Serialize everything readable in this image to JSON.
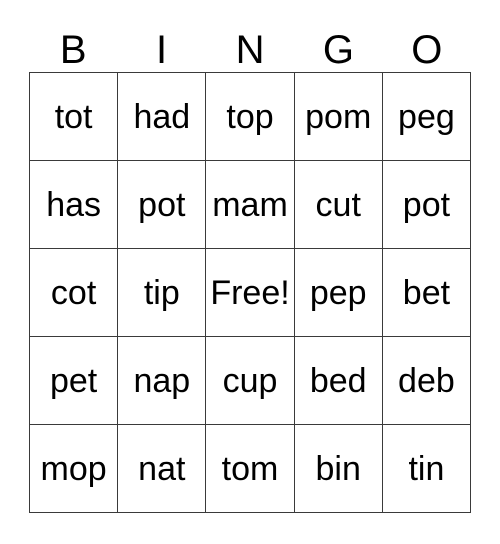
{
  "card": {
    "header_letters": [
      "B",
      "I",
      "N",
      "G",
      "O"
    ],
    "free_space_label": "Free!",
    "free_space_position": {
      "row": 2,
      "col": 2
    },
    "grid_size": {
      "rows": 5,
      "cols": 5
    },
    "colors": {
      "background": "#ffffff",
      "text": "#000000",
      "border": "#3a3a3a"
    },
    "rows": [
      {
        "cells": [
          "tot",
          "had",
          "top",
          "pom",
          "peg"
        ]
      },
      {
        "cells": [
          "has",
          "pot",
          "mam",
          "cut",
          "pot"
        ]
      },
      {
        "cells": [
          "cot",
          "tip",
          "Free!",
          "pep",
          "bet"
        ]
      },
      {
        "cells": [
          "pet",
          "nap",
          "cup",
          "bed",
          "deb"
        ]
      },
      {
        "cells": [
          "mop",
          "nat",
          "tom",
          "bin",
          "tin"
        ]
      }
    ]
  }
}
